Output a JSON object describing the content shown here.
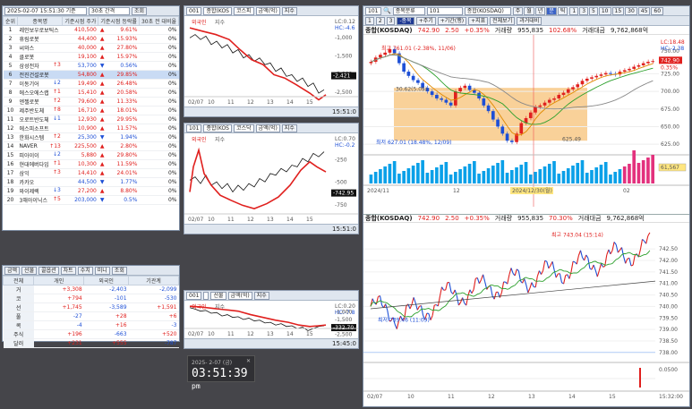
{
  "colors": {
    "up": "#e0201e",
    "down": "#1d4fd6",
    "zone": "#f7c57f",
    "volume": "#0aa0e8",
    "spike": "#e3317d"
  },
  "rank": {
    "time": "2025-02-07 15:51:30 기준",
    "period": "30초 간격",
    "query": "조회",
    "headers": [
      "순위",
      "종목명",
      "기준시점 주가",
      "기준시점 등락률",
      "30초 전 대비율"
    ],
    "rows": [
      [
        "1",
        "레인보우로보틱스",
        "",
        "410,500",
        "▲",
        "9.61%",
        "0%"
      ],
      [
        "2",
        "휴림로봇",
        "",
        "44,400",
        "▲",
        "15.93%",
        "0%"
      ],
      [
        "3",
        "씨와스",
        "",
        "40,000",
        "▲",
        "27.80%",
        "0%"
      ],
      [
        "4",
        "클로봇",
        "",
        "19,100",
        "▲",
        "15.97%",
        "0%"
      ],
      [
        "5",
        "삼성전자",
        "↑3",
        "53,700",
        "▼",
        "0.56%",
        "0%"
      ],
      [
        "6",
        "전진건설로봇",
        "",
        "54,800",
        "▲",
        "29.85%",
        "0%"
      ],
      [
        "7",
        "이동기어",
        "↓2",
        "19,490",
        "▲",
        "26.48%",
        "0%"
      ],
      [
        "8",
        "에스오에스랩",
        "↑1",
        "15,410",
        "▲",
        "20.58%",
        "0%"
      ],
      [
        "9",
        "엔젤로봇",
        "↑2",
        "79,600",
        "▲",
        "11.33%",
        "0%"
      ],
      [
        "10",
        "제주반도체",
        "↑8",
        "16,710",
        "▲",
        "18.01%",
        "0%"
      ],
      [
        "11",
        "오로트반도체",
        "↓1",
        "12,930",
        "▲",
        "29.95%",
        "0%"
      ],
      [
        "12",
        "에스피소프트",
        "",
        "10,900",
        "▲",
        "11.57%",
        "0%"
      ],
      [
        "13",
        "한화시스템",
        "↑2",
        "25,300",
        "▼",
        "1.94%",
        "0%"
      ],
      [
        "14",
        "NAVER",
        "↑13",
        "225,500",
        "▲",
        "2.80%",
        "0%"
      ],
      [
        "15",
        "피아이이",
        "↓2",
        "5,880",
        "▲",
        "29.80%",
        "0%"
      ],
      [
        "16",
        "현대에버다임",
        "↑1",
        "10,300",
        "▲",
        "11.59%",
        "0%"
      ],
      [
        "17",
        "삼익",
        "↑3",
        "14,410",
        "▲",
        "24.01%",
        "0%"
      ],
      [
        "18",
        "카카오",
        "",
        "44,500",
        "▼",
        "1.77%",
        "0%"
      ],
      [
        "19",
        "와이제렉",
        "↓3",
        "27,200",
        "▲",
        "8.80%",
        "0%"
      ],
      [
        "20",
        "3해아이닉스",
        "↑5",
        "203,000",
        "▼",
        "0.5%",
        "0%"
      ]
    ]
  },
  "investor": {
    "toolbar": [
      "금액",
      "선물",
      "콜옵션",
      "차트",
      "수치",
      "미니",
      "조회"
    ],
    "headers": [
      "전체",
      "개인",
      "외국인",
      "기관계"
    ],
    "rows": [
      [
        "거",
        "+3,308",
        "-2,403",
        "-2,099"
      ],
      [
        "코",
        "+794",
        "-101",
        "-530"
      ],
      [
        "선",
        "+1,745",
        "-3,589",
        "+1,591"
      ],
      [
        "풀",
        "-27",
        "+28",
        "+6"
      ],
      [
        "콕",
        "-4",
        "+16",
        "-3"
      ],
      [
        "주식",
        "+196",
        "-663",
        "+520"
      ],
      [
        "달러",
        "+231",
        "+555",
        "-787"
      ]
    ]
  },
  "mini_charts": [
    {
      "code": "001",
      "market": "종합(KOS",
      "type": "코스피",
      "unit": "금액(억)",
      "flag": "지수",
      "legend_a": "외국인",
      "legend_b": "지수",
      "scale": "LC:0.12",
      "scale2": "HC:-4.6",
      "ticks": [
        "-1,000",
        "-1,500",
        "-2,000",
        "-2,500"
      ],
      "dates": [
        "02/07",
        "10",
        "11",
        "12",
        "13",
        "14",
        "15"
      ],
      "time": "15:51:0",
      "value": "-2,421"
    },
    {
      "code": "101",
      "market": "종합(KOS",
      "type": "코스닥",
      "unit": "금액(억)",
      "flag": "지수",
      "legend_a": "외국인",
      "legend_b": "지수",
      "scale": "LC:0.70",
      "scale2": "HC:-0.2",
      "ticks": [
        "-250",
        "-500",
        "-750"
      ],
      "dates": [
        "02/07",
        "10",
        "11",
        "12",
        "13",
        "14",
        "15"
      ],
      "time": "15:51:0",
      "value": "-742.95"
    },
    {
      "code": "001",
      "market": "",
      "type": "선물",
      "unit": "금액(억)",
      "flag": "지수",
      "legend_a": "외국인",
      "legend_b": "지수",
      "scale": "LC:0.20",
      "scale2": "HC:-7.8",
      "ticks": [
        "-1,000",
        "-1,500",
        "-2,000",
        "-2,500"
      ],
      "dates": [
        "02/07",
        "10",
        "11",
        "12",
        "13",
        "14",
        "15"
      ],
      "time": "15:45:0",
      "value": "-332.70"
    }
  ],
  "clock": {
    "date": "2025- 2-07 (금)",
    "time": "03:51:39",
    "ampm": "pm"
  },
  "main": {
    "code": "101",
    "category": "종목분류",
    "market": "종합(KOSDAQ)",
    "tabs": [
      "1",
      "2",
      "3"
    ],
    "chart_types": [
      "주",
      "월",
      "년",
      "분",
      "틱"
    ],
    "toolbar": [
      "-종목",
      "+주기",
      "+기간(행)",
      "+지표",
      "전체보기",
      "과거대비"
    ],
    "period_btns": [
      "1",
      "3",
      "5",
      "10",
      "15",
      "30",
      "45",
      "60"
    ],
    "small_btns": [
      "X",
      "1",
      "",
      ""
    ],
    "header": {
      "name": "종합(KOSDAQ)",
      "price": "742.90",
      "change": "2.50",
      "rate": "+0.35%",
      "label_vol": "거래량",
      "vol": "955,835",
      "ratio": "102.68%",
      "label_amt": "거래대금",
      "amt": "9,762,868억"
    },
    "header_intraday": {
      "name": "종합(KOSDAQ)",
      "price": "742.90",
      "change": "2.50",
      "rate": "+0.35%",
      "label_vol": "거래량",
      "vol": "955,835",
      "ratio": "70.30%",
      "label_amt": "거래대금",
      "amt": "9,762,868억"
    },
    "right_info": [
      "1",
      "0",
      "",
      "2025"
    ],
    "daily": {
      "high": "최고 761.01 (-2.38%, 11/06)",
      "low": "최저 627.01 (18.48%, 12/09)",
      "pct1": "30.62(5.05)",
      "pct2": "625.49",
      "axis": [
        "725.00",
        "700.00",
        "675.00",
        "650.00",
        "625.00"
      ],
      "lc": "LC:18.48",
      "hc": "HC:-2.38",
      "right_vol": "61,567",
      "dates": [
        "2024/11",
        "12",
        "2024/12/30(월)",
        "02"
      ],
      "price_tag": "742.90",
      "rate_tag": "0.35%",
      "pct_top": "750.00"
    },
    "intra": {
      "high": "최고 743.04 (15:14)",
      "low": "최저 739.46 (11:09)",
      "axis": [
        "742.50",
        "742.00",
        "741.50",
        "741.00",
        "740.50",
        "740.00",
        "739.50",
        "739.00",
        "738.50",
        "738.00"
      ],
      "right_vol": "0.0500",
      "dates": [
        "02/07",
        "10",
        "11",
        "12",
        "13",
        "14",
        "15"
      ],
      "time": "15:32:00"
    }
  }
}
